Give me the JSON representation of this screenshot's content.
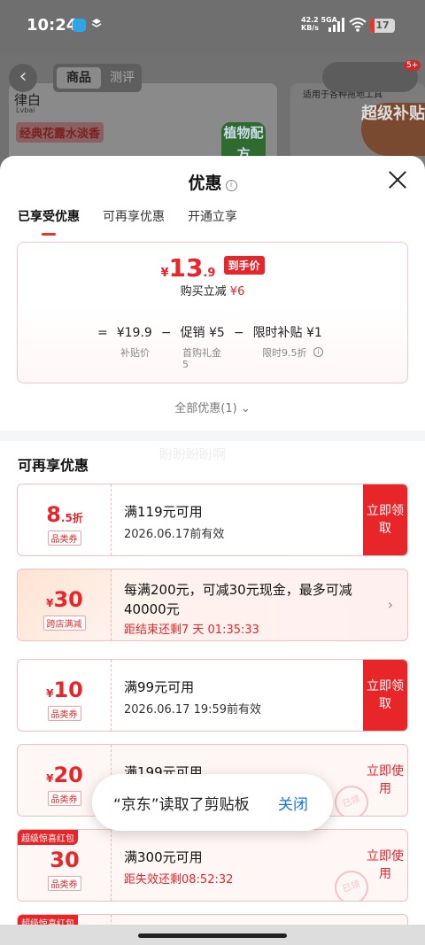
{
  "status_bar": {
    "time": "10:24",
    "net_speed": "42.2",
    "net_unit": "KB/s",
    "network": "5GA",
    "battery": "17"
  },
  "background": {
    "tabs": [
      "商品",
      "测评"
    ],
    "brand": "律白",
    "brand_sub": "Lvbai",
    "slogan": "经典花露水淡香",
    "product_label": "植物配方",
    "tools_label": "适用于各种拖地工具",
    "subsidy_label": "超级补贴",
    "cart_badge": "5+"
  },
  "sheet": {
    "title": "优惠",
    "tabs": [
      "已享受优惠",
      "可再享优惠",
      "开通立享"
    ],
    "summary": {
      "currency": "¥",
      "final_int": "13",
      "final_dec": ".9",
      "final_tag": "到手价",
      "save_text": "购买立减",
      "save_amount": "¥6",
      "formula": {
        "eq": "=",
        "base": "¥19.9",
        "minus1": "−",
        "promo": "促销 ¥5",
        "minus2": "−",
        "subsidy": "限时补贴 ¥1"
      },
      "base_label": "补贴价",
      "promo_label": "首购礼金",
      "promo_value": "5",
      "subsidy_label": "限时9.5折"
    },
    "all_link": "全部优惠(1)",
    "watermark": "盼盼盼盼啊",
    "section_title": "可再享优惠"
  },
  "coupons": [
    {
      "amount": "8",
      "amount_small": ".5折",
      "tag": "品类券",
      "title": "满119元可用",
      "sub": "2026.06.17前有效",
      "btn": "立即领取"
    },
    {
      "currency": "¥",
      "amount": "30",
      "tag": "跨店满减",
      "title": "每满200元，可减30元现金，最多可减40000元",
      "sub": "距结束还剩7 天 01:35:33"
    },
    {
      "currency": "¥",
      "amount": "10",
      "tag": "品类券",
      "title": "满99元可用",
      "sub": "2026.06.17 19:59前有效",
      "btn": "立即领取"
    },
    {
      "currency": "¥",
      "amount": "20",
      "tag": "品类券",
      "title": "满199元可用",
      "btn": "立即使用",
      "stamp": "已领"
    },
    {
      "top_tag": "超级惊喜红包",
      "amount": "30",
      "tag": "品类券",
      "title": "满300元可用",
      "sub": "距失效还剩08:52:32",
      "btn": "立即使用",
      "stamp": "已领"
    },
    {
      "top_tag": "超级惊喜红包"
    }
  ],
  "toast": {
    "message": "“京东”读取了剪贴板",
    "close": "关闭"
  }
}
